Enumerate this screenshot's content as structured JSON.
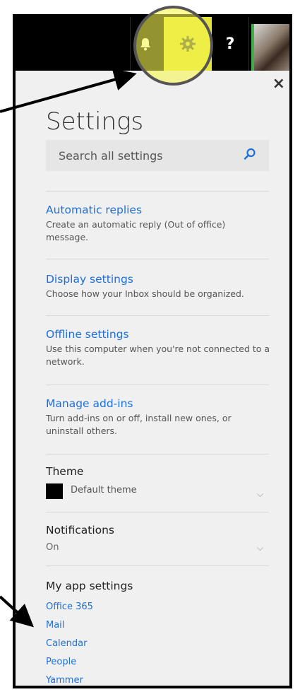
{
  "topbar": {
    "bell_icon": "bell-icon",
    "gear_icon": "gear-icon",
    "help_label": "?"
  },
  "panel": {
    "close_label": "×",
    "title": "Settings",
    "search_placeholder": "Search all settings",
    "items": [
      {
        "title": "Automatic replies",
        "desc": "Create an automatic reply (Out of office) message."
      },
      {
        "title": "Display settings",
        "desc": "Choose how your Inbox should be organized."
      },
      {
        "title": "Offline settings",
        "desc": "Use this computer when you're not connected to a network."
      },
      {
        "title": "Manage add-ins",
        "desc": "Turn add-ins on or off, install new ones, or uninstall others."
      }
    ],
    "theme": {
      "heading": "Theme",
      "value": "Default theme"
    },
    "notifications": {
      "heading": "Notifications",
      "value": "On"
    },
    "app_settings": {
      "heading": "My app settings",
      "links": [
        "Office 365",
        "Mail",
        "Calendar",
        "People",
        "Yammer"
      ]
    }
  },
  "colors": {
    "accent": "#1e6fd9",
    "highlight": "#f5f550",
    "panel_bg": "#f0f0f0"
  }
}
